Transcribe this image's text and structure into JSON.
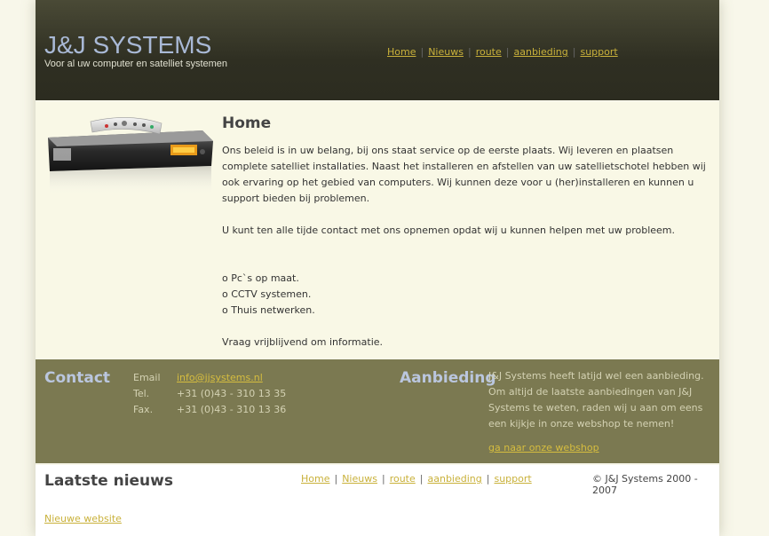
{
  "header": {
    "logo": "J&J SYSTEMS",
    "tagline": "Voor al uw computer en satelliet systemen",
    "nav": [
      "Home",
      "Nieuws",
      "route",
      "aanbieding",
      "support"
    ],
    "nav_separator": "|"
  },
  "main": {
    "heading": "Home",
    "image_icon": "satellite-receiver-with-remote-icon",
    "paragraph1": "Ons beleid is in uw belang, bij ons staat service op de eerste plaats. Wij leveren en plaatsen complete satelliet installaties. Naast het installeren en afstellen van uw satellietschotel hebben wij ook ervaring op het gebied van computers. Wij kunnen deze voor u (her)installeren en kunnen u support bieden bij problemen.",
    "paragraph2": "U kunt ten alle tijde contact met ons opnemen opdat wij u kunnen helpen met uw probleem.",
    "services": [
      "o Pc`s op maat.",
      "o CCTV systemen.",
      "o Thuis netwerken."
    ],
    "closing": "Vraag vrijblijvend om informatie."
  },
  "contact": {
    "title": "Contact",
    "labels": [
      "Email",
      "Tel.",
      "Fax."
    ],
    "email": "info@jjsystems.nl",
    "tel": "+31 (0)43 - 310 13 35",
    "fax": "+31 (0)43 - 310 13 36"
  },
  "offer": {
    "title": "Aanbieding",
    "text": "J&J Systems heeft latijd wel een aanbieding. Om altijd de laatste aanbiedingen van J&J Systems te weten, raden wij u aan om eens een kijkje in onze webshop te nemen!",
    "link": "ga naar onze webshop"
  },
  "footer": {
    "news_title": "Laatste nieuws",
    "nav": [
      "Home",
      "Nieuws",
      "route",
      "aanbieding",
      "support"
    ],
    "nav_separator": "|",
    "copyright": "© J&J Systems 2000 - 2007",
    "news_link": "Nieuwe website"
  },
  "colors": {
    "header_bg": "#2f2f22",
    "content_bg": "#f9f8e6",
    "band_bg": "#7b7951",
    "link": "#c9b13a",
    "title_blue": "#bac6de"
  }
}
